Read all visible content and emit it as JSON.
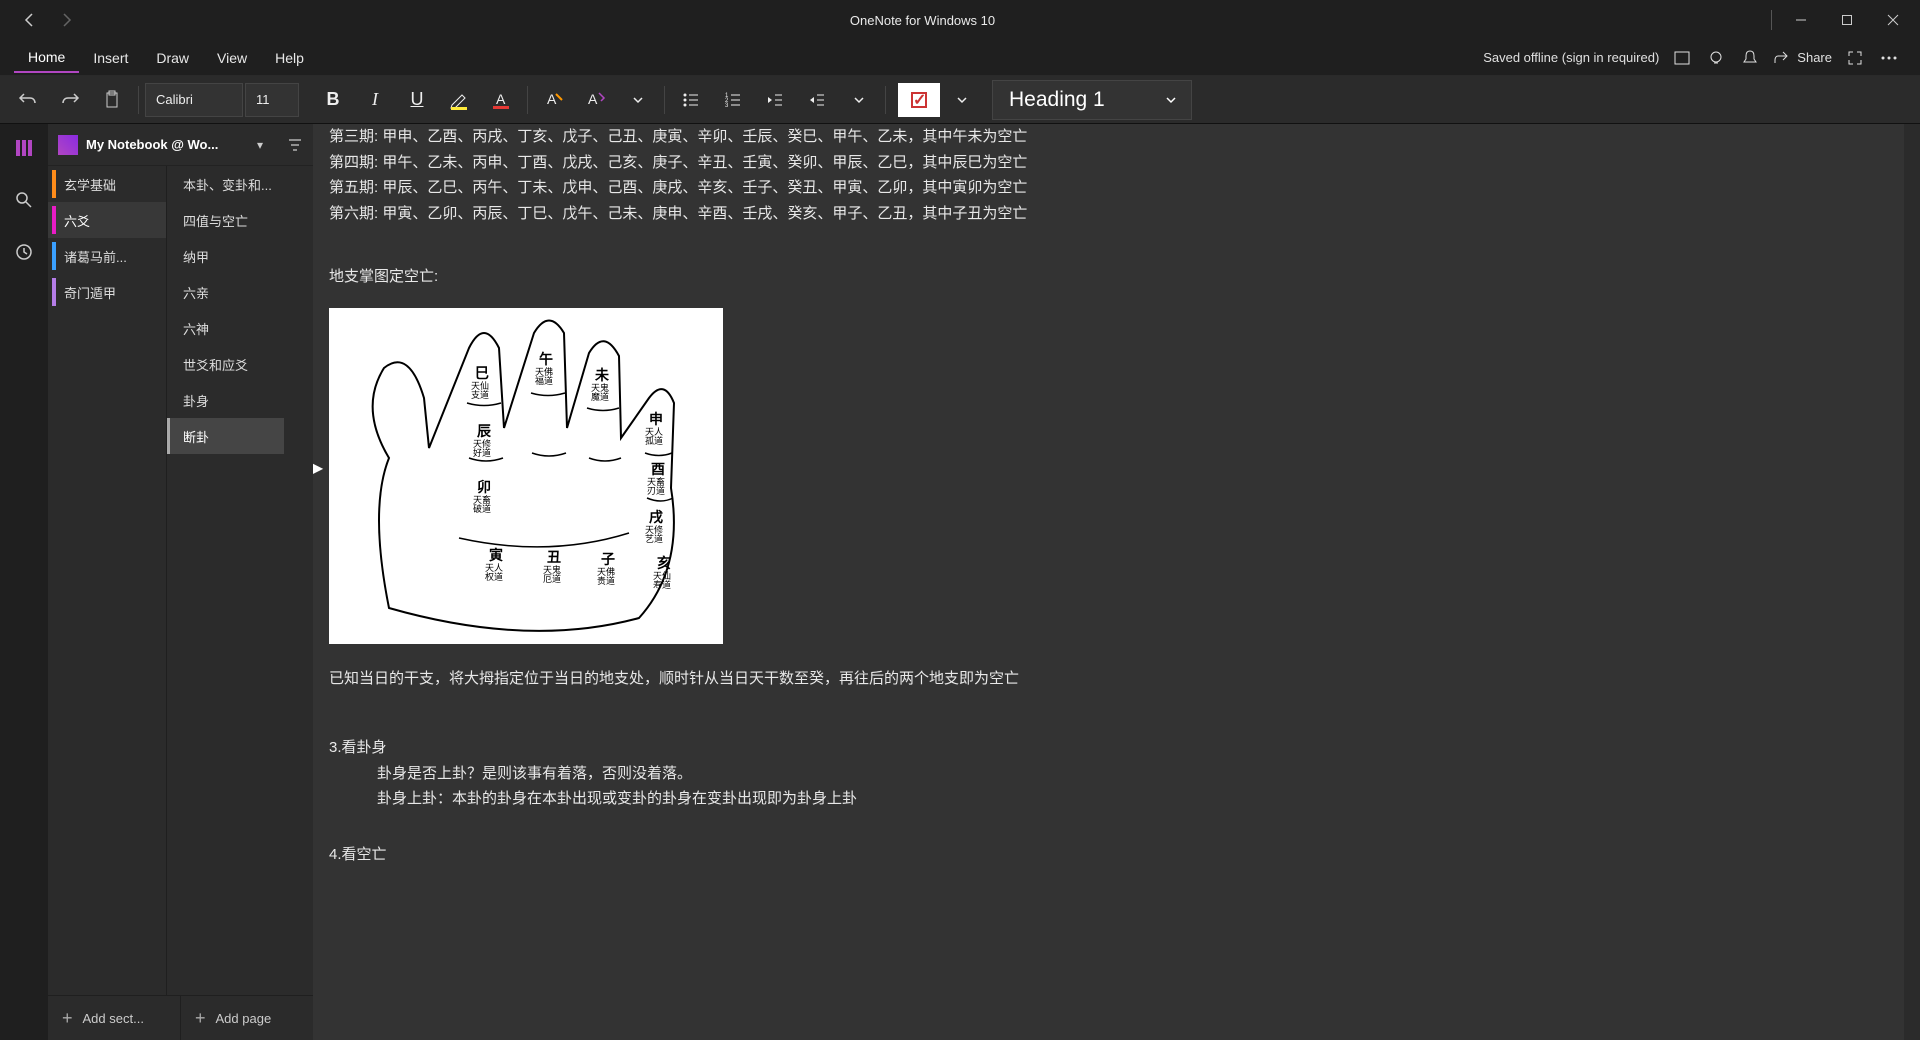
{
  "window": {
    "title": "OneNote for Windows 10"
  },
  "menu": {
    "home": "Home",
    "insert": "Insert",
    "draw": "Draw",
    "view": "View",
    "help": "Help",
    "saved_status": "Saved offline (sign in required)",
    "share": "Share"
  },
  "toolbar": {
    "font_name": "Calibri",
    "font_size": "11",
    "style_selected": "Heading 1"
  },
  "notebook": {
    "name": "My Notebook @ Wo..."
  },
  "sections": [
    {
      "label": "玄学基础",
      "color": "#ff8c1a"
    },
    {
      "label": "六爻",
      "color": "#e81cc5",
      "active": true
    },
    {
      "label": "诸葛马前...",
      "color": "#3aa0ff"
    },
    {
      "label": "奇门遁甲",
      "color": "#b57de8"
    }
  ],
  "pages": [
    {
      "label": "本卦、变卦和..."
    },
    {
      "label": "四值与空亡"
    },
    {
      "label": "纳甲"
    },
    {
      "label": "六亲"
    },
    {
      "label": "六神"
    },
    {
      "label": "世爻和应爻"
    },
    {
      "label": "卦身"
    },
    {
      "label": "断卦",
      "active": true
    }
  ],
  "footer": {
    "add_section": "Add sect...",
    "add_page": "Add page"
  },
  "content": {
    "periods": [
      "第三期:  甲申、乙酉、丙戌、丁亥、戊子、己丑、庚寅、辛卯、壬辰、癸巳、甲午、乙未，其中午未为空亡",
      "第四期:  甲午、乙未、丙申、丁酉、戊戌、己亥、庚子、辛丑、壬寅、癸卯、甲辰、乙巳，其中辰巳为空亡",
      "第五期:  甲辰、乙巳、丙午、丁未、戊申、己酉、庚戌、辛亥、壬子、癸丑、甲寅、乙卯，其中寅卯为空亡",
      "第六期:  甲寅、乙卯、丙辰、丁巳、戊午、己未、庚申、辛酉、壬戌、癸亥、甲子、乙丑，其中子丑为空亡"
    ],
    "hand_title": "地支掌图定空亡:",
    "hand_explain": "已知当日的干支，将大拇指定位于当日的地支处，顺时针从当日天干数至癸，再往后的两个地支即为空亡",
    "heading3": "3.看卦身",
    "body3a": "卦身是否上卦？是则该事有着落，否则没着落。",
    "body3b": "卦身上卦：本卦的卦身在本卦出现或变卦的卦身在变卦出现即为卦身上卦",
    "heading4": "4.看空亡"
  },
  "hand_labels": {
    "si": "巳",
    "si_sub": "天仙\n支道",
    "wu": "午",
    "wu_sub": "天佛\n福道",
    "wei": "未",
    "wei_sub": "天鬼\n魔道",
    "shen": "申",
    "shen_sub": "天人\n孤道",
    "chen": "辰",
    "chen_sub": "天修\n好道",
    "you": "酉",
    "you_sub": "天畜\n刃道",
    "mao": "卯",
    "mao_sub": "天畜\n破道",
    "xu": "戌",
    "xu_sub": "天修\n艺道",
    "yin": "寅",
    "yin_sub": "天人\n权道",
    "chou": "丑",
    "chou_sub": "天鬼\n厄道",
    "zi": "子",
    "zi_sub": "天佛\n贵道",
    "hai": "亥",
    "hai_sub": "天仙\n寿道"
  }
}
